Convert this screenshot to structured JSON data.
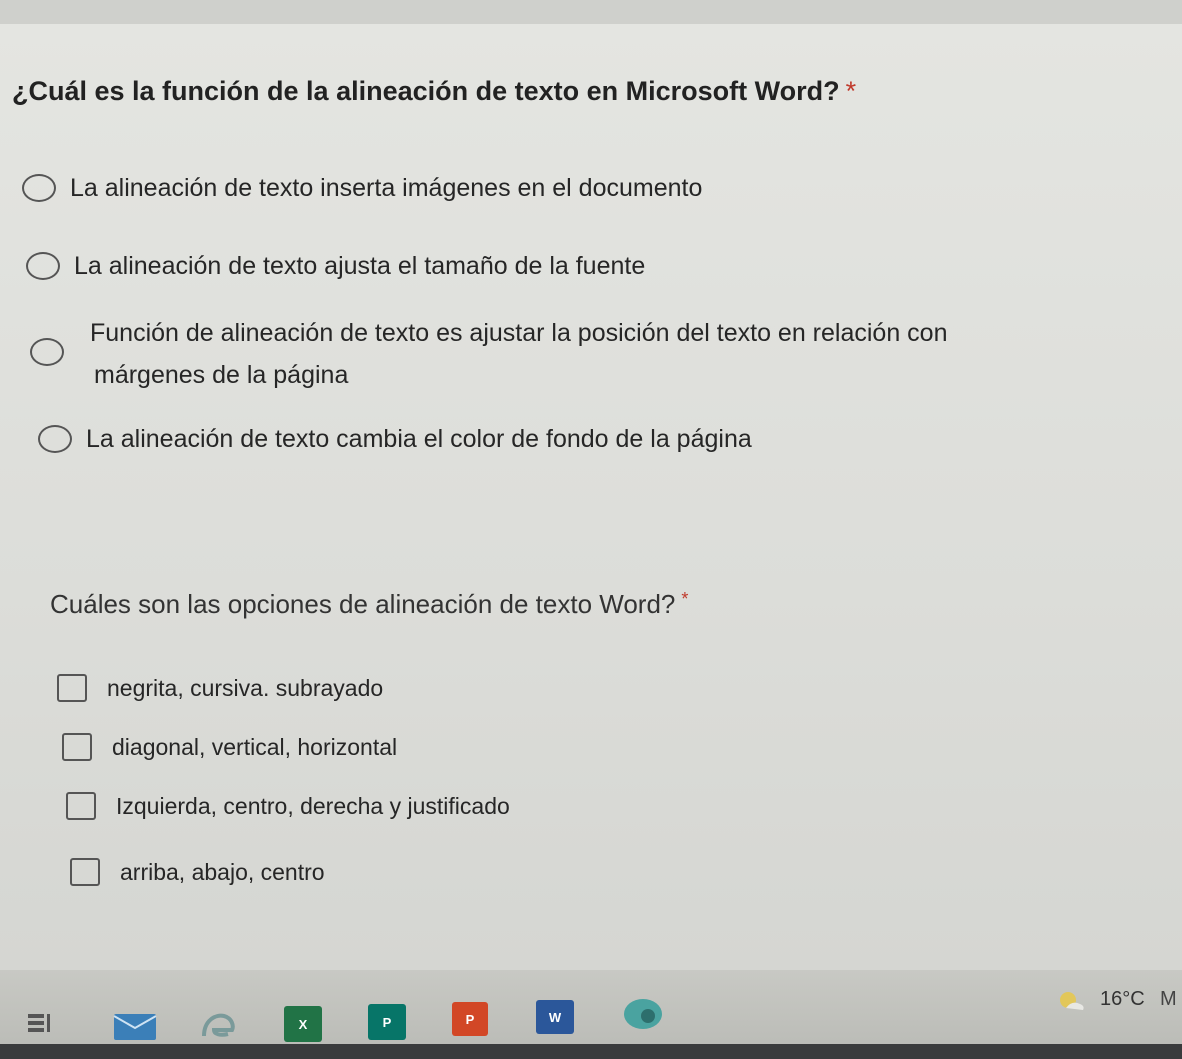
{
  "question1": {
    "title": "¿Cuál es la función de la alineación de texto en Microsoft Word?",
    "required_mark": "*",
    "options": [
      "La alineación de texto inserta imágenes en el documento",
      "La alineación de texto ajusta el tamaño de la fuente",
      "Función de alineación de texto es ajustar la posición del texto en relación con",
      "márgenes de la página",
      "La alineación de texto cambia el color de fondo de la página"
    ]
  },
  "question2": {
    "title": "Cuáles son las opciones de alineación de texto Word?",
    "required_mark": "*",
    "options": [
      "negrita, cursiva. subrayado",
      "diagonal, vertical, horizontal",
      "Izquierda, centro, derecha y justificado",
      "arriba, abajo, centro"
    ]
  },
  "taskbar": {
    "weather": "16°C",
    "trailing": "M",
    "icons": [
      "task-view-icon",
      "mail-icon",
      "edge-icon",
      "excel-icon",
      "publisher-icon",
      "powerpoint-icon",
      "word-icon",
      "photos-icon",
      "weather-icon"
    ],
    "excel_letter": "X",
    "publisher_letter": "P",
    "powerpoint_letter": "P",
    "word_letter": "W"
  },
  "colors": {
    "required": "#c0392b",
    "excel": "#217346",
    "word": "#2b579a",
    "powerpoint": "#d24726",
    "publisher": "#077568"
  }
}
